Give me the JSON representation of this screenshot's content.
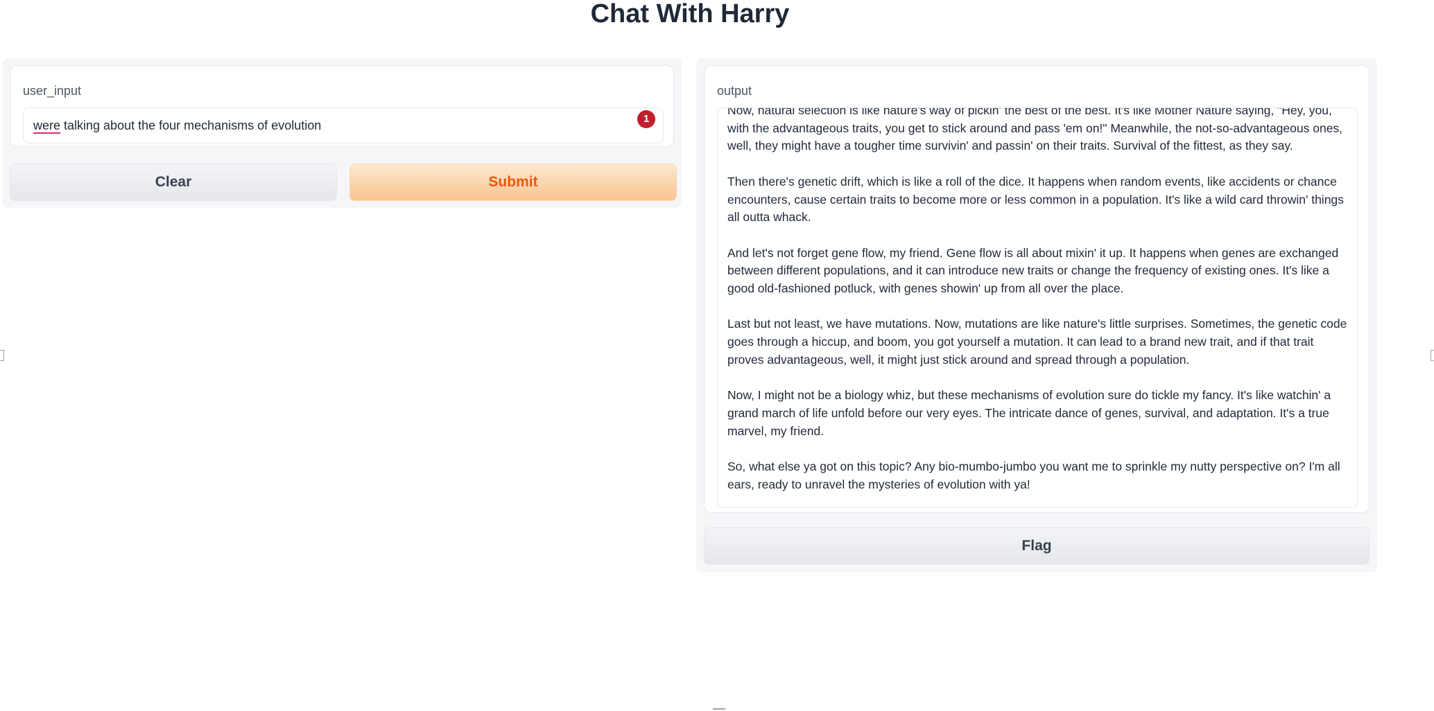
{
  "header": {
    "title": "Chat With Harry"
  },
  "input": {
    "label": "user_input",
    "value_first_word": "were",
    "value_rest": " talking about the four mechanisms of evolution",
    "error_count": "1"
  },
  "buttons": {
    "clear": "Clear",
    "submit": "Submit",
    "flag": "Flag"
  },
  "output": {
    "label": "output",
    "paragraphs": [
      "Now, natural selection is like nature's way of pickin' the best of the best. It's like Mother Nature saying, \"Hey, you, with the advantageous traits, you get to stick around and pass 'em on!\" Meanwhile, the not-so-advantageous ones, well, they might have a tougher time survivin' and passin' on their traits. Survival of the fittest, as they say.",
      "Then there's genetic drift, which is like a roll of the dice. It happens when random events, like accidents or chance encounters, cause certain traits to become more or less common in a population. It's like a wild card throwin' things all outta whack.",
      "And let's not forget gene flow, my friend. Gene flow is all about mixin' it up. It happens when genes are exchanged between different populations, and it can introduce new traits or change the frequency of existing ones. It's like a good old-fashioned potluck, with genes showin' up from all over the place.",
      "Last but not least, we have mutations. Now, mutations are like nature's little surprises. Sometimes, the genetic code goes through a hiccup, and boom, you got yourself a mutation. It can lead to a brand new trait, and if that trait proves advantageous, well, it might just stick around and spread through a population.",
      "Now, I might not be a biology whiz, but these mechanisms of evolution sure do tickle my fancy. It's like watchin' a grand march of life unfold before our very eyes. The intricate dance of genes, survival, and adaptation. It's a true marvel, my friend.",
      "So, what else ya got on this topic? Any bio-mumbo-jumbo you want me to sprinkle my nutty perspective on? I'm all ears, ready to unravel the mysteries of evolution with ya!"
    ]
  },
  "colors": {
    "primary_button": "#f9c48e",
    "primary_text": "#ea580c",
    "error_badge": "#c01f2f"
  }
}
